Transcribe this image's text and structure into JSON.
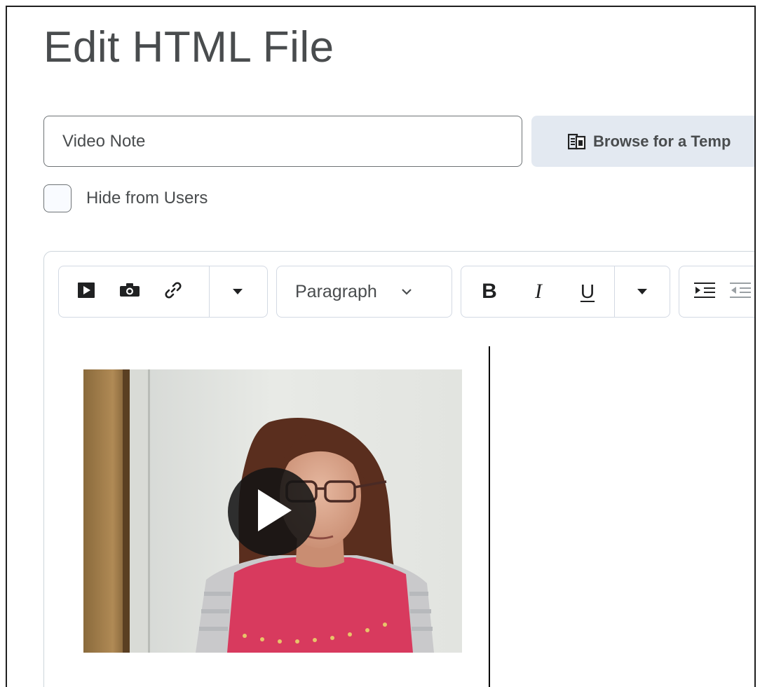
{
  "page": {
    "title": "Edit HTML File"
  },
  "form": {
    "title_input_value": "Video Note",
    "browse_button_label": "Browse for a Temp",
    "hide_checkbox_label": "Hide from Users",
    "hide_checkbox_checked": false
  },
  "toolbar": {
    "format_select_value": "Paragraph",
    "bold_label": "B",
    "italic_label": "I",
    "underline_label": "U"
  },
  "colors": {
    "text": "#494c4e",
    "button_bg": "#e3e9f1",
    "border": "#cdd5dc",
    "shirt": "#d83a5e"
  }
}
